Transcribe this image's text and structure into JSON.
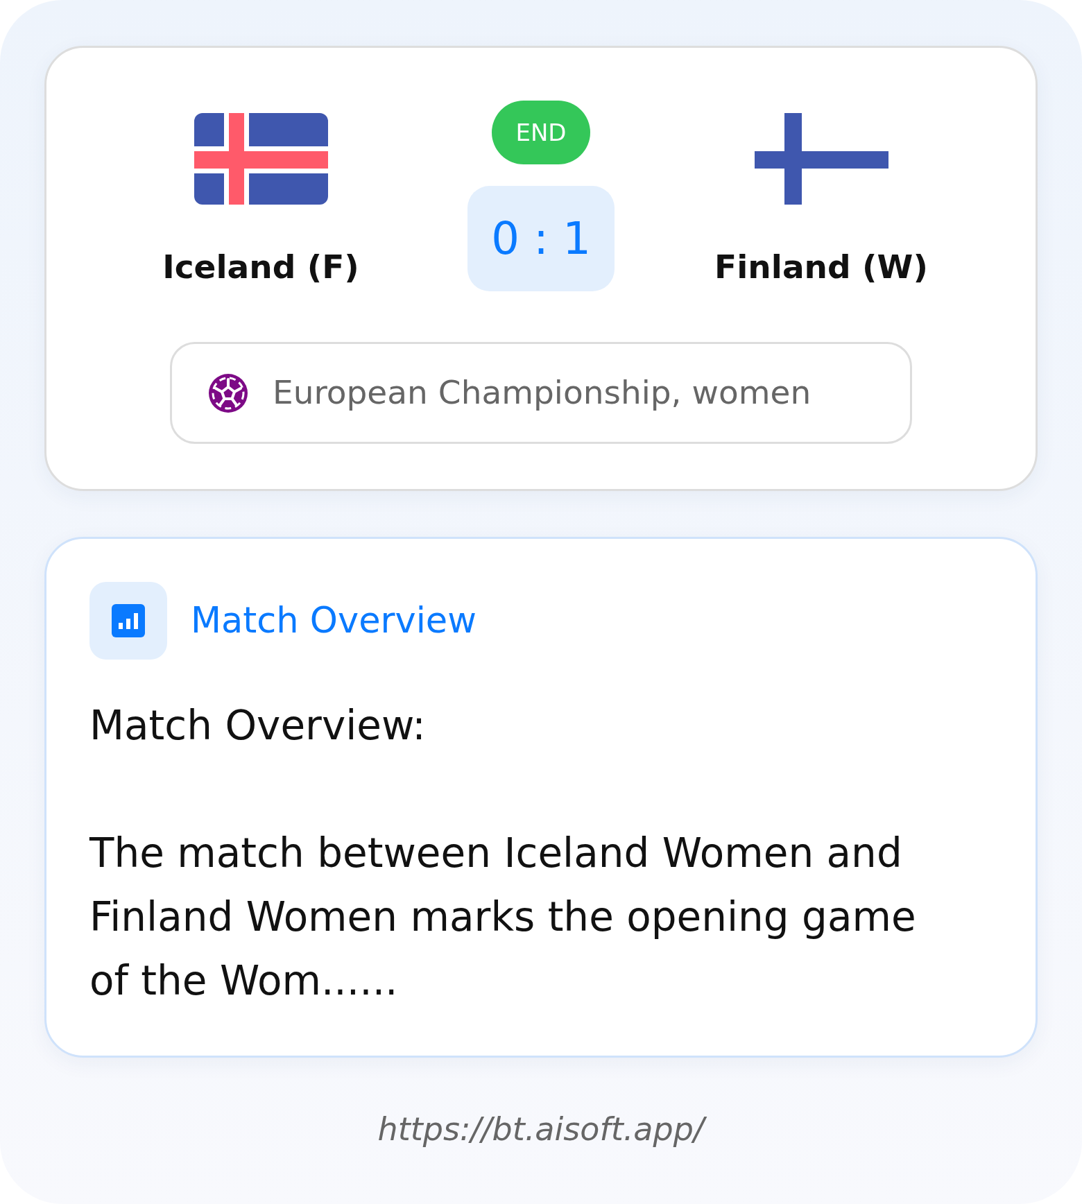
{
  "match": {
    "status": "END",
    "score": "0 : 1",
    "teams": [
      {
        "name": "Iceland (F)",
        "kind": "iceland"
      },
      {
        "name": "Finland (W)",
        "kind": "finland"
      }
    ],
    "competition": "European Championship, women"
  },
  "overview": {
    "title": "Match Overview",
    "heading": "Match Overview:",
    "paragraph": "The match between Iceland Women and Finland Women marks the opening game of the Wom......"
  },
  "footer": {
    "url": "https://bt.aisoft.app/"
  }
}
